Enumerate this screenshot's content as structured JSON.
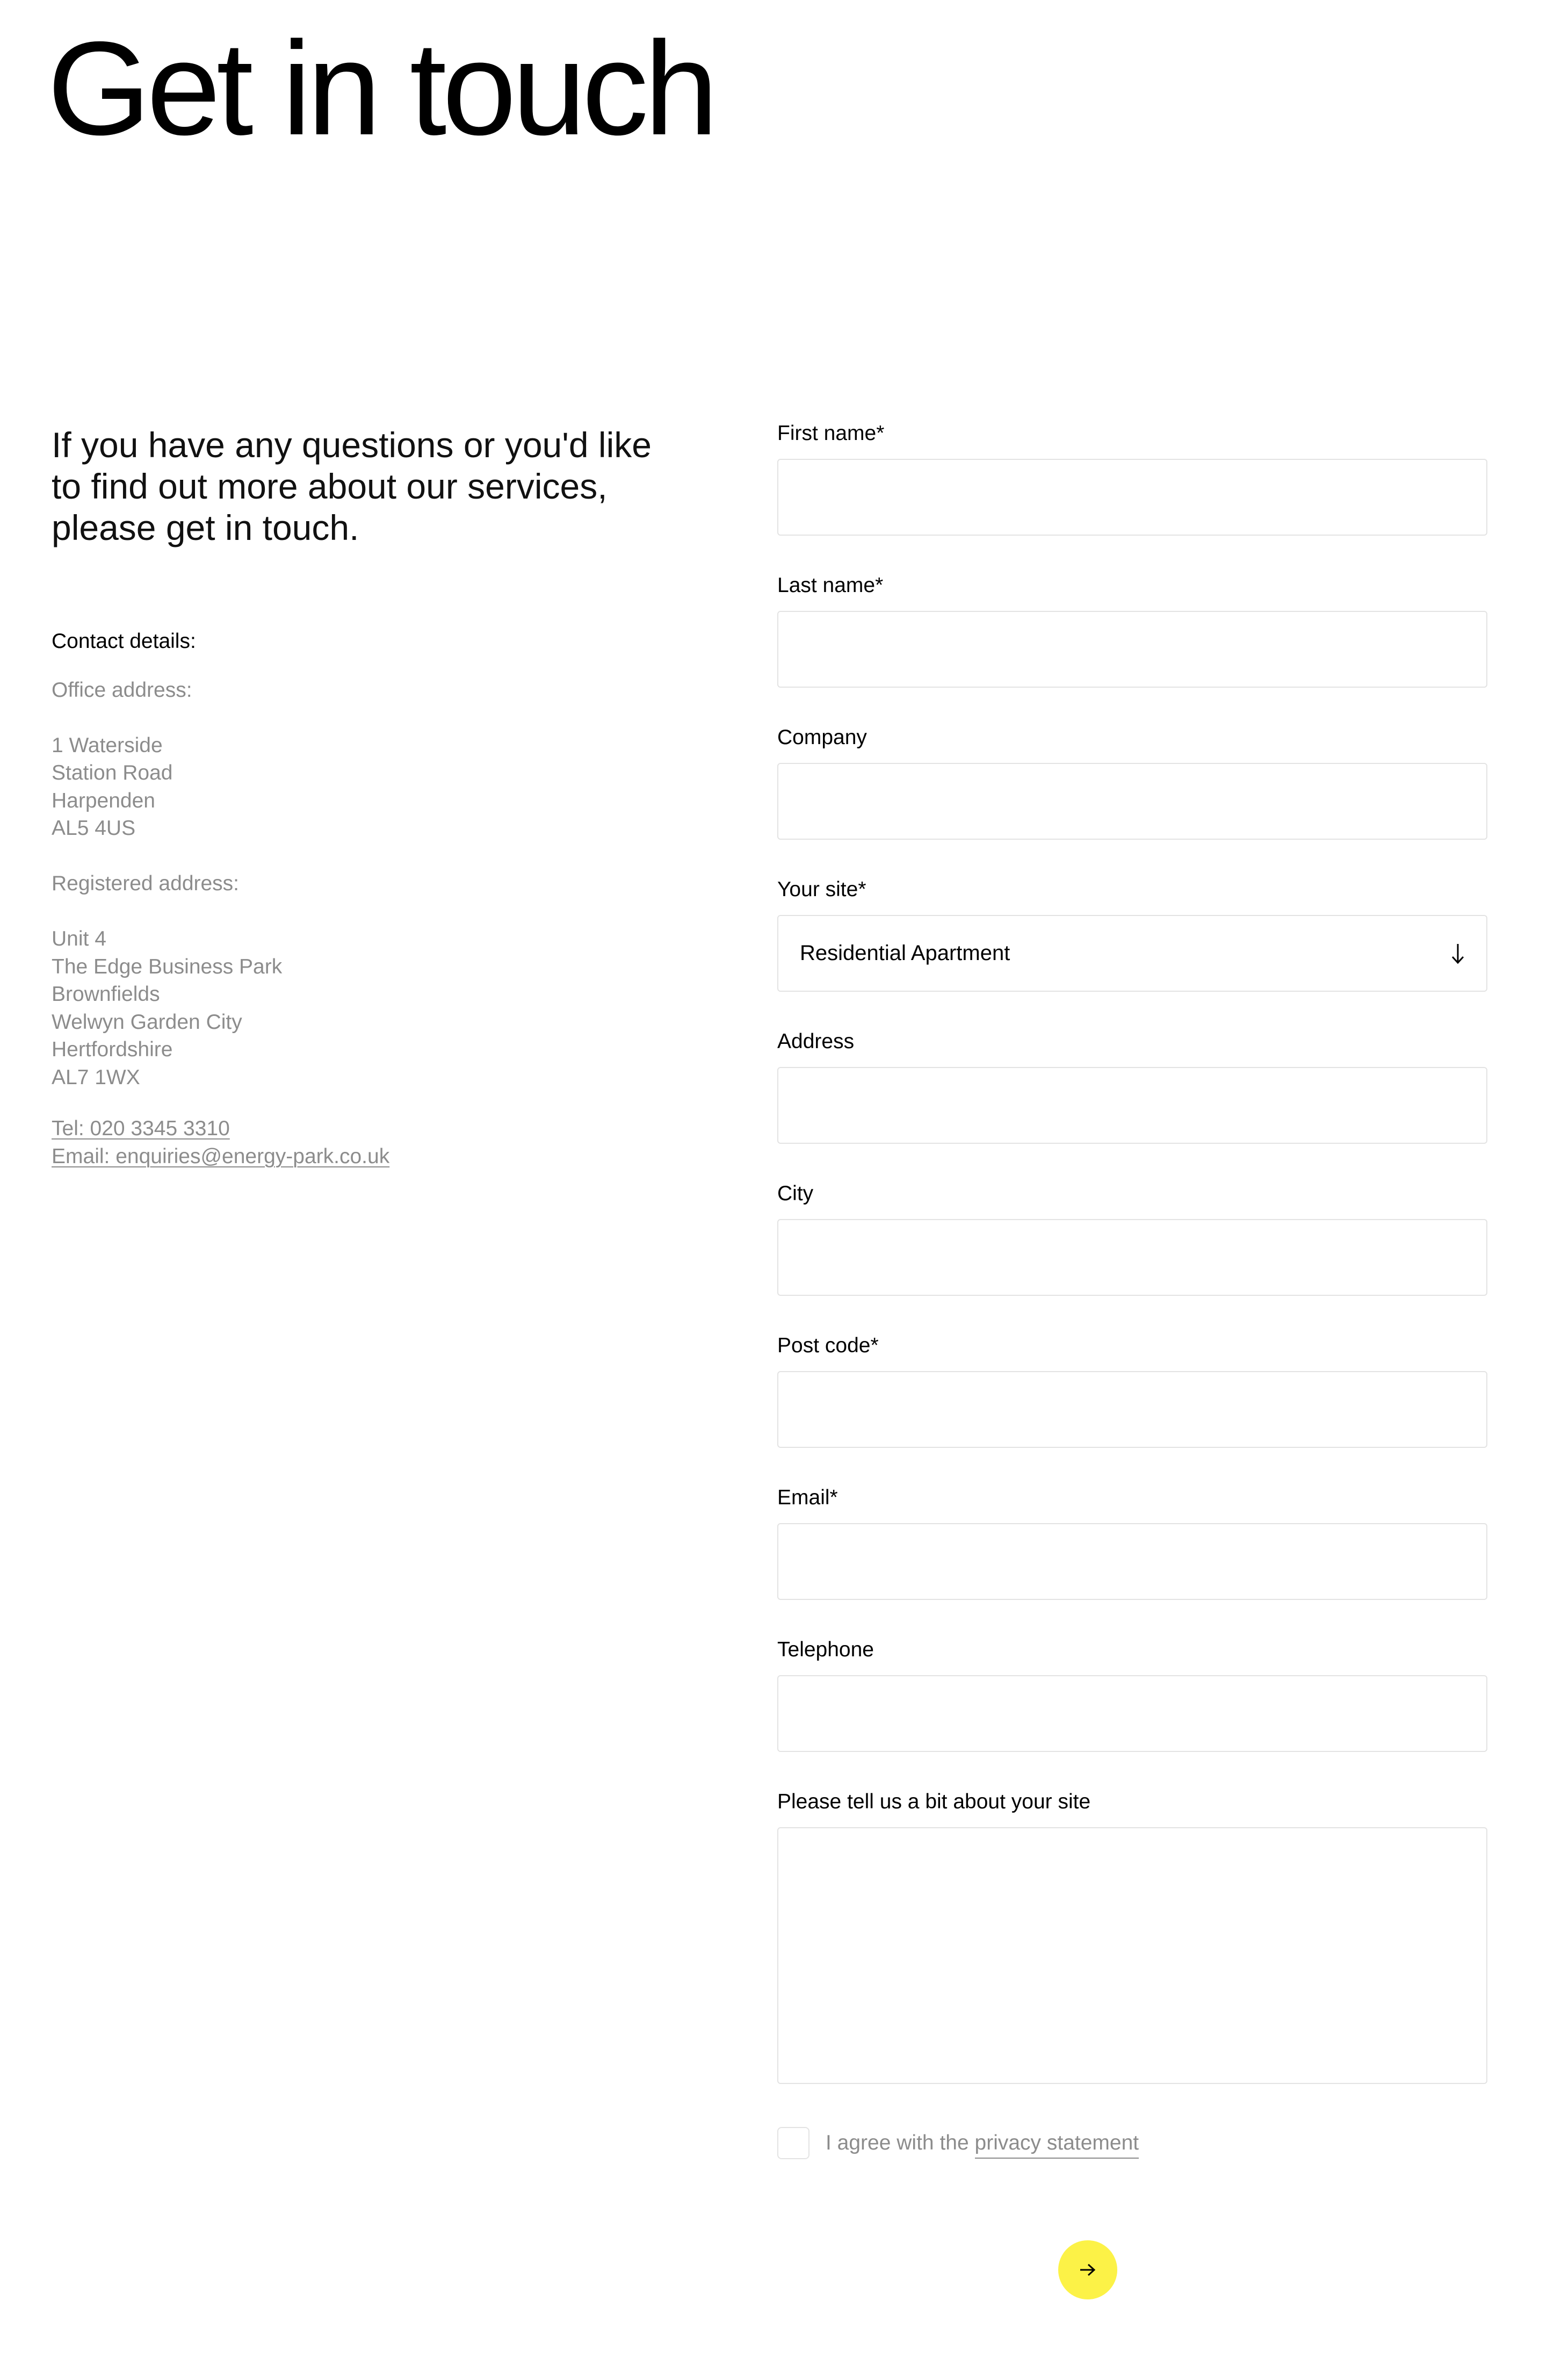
{
  "page": {
    "title": "Get in touch",
    "intro": "If you have any questions or you'd like to find out more about our services, please get in touch."
  },
  "contact": {
    "heading": "Contact details:",
    "office_label": "Office address:",
    "office_address": [
      "1 Waterside",
      "Station Road",
      "Harpenden",
      "AL5 4US"
    ],
    "registered_label": "Registered address:",
    "registered_address": [
      "Unit 4",
      "The Edge Business Park",
      "Brownfields",
      "Welwyn Garden City",
      "Hertfordshire",
      "AL7 1WX"
    ],
    "phone_link": "Tel: 020 3345 3310",
    "email_link": "Email: enquiries@energy-park.co.uk"
  },
  "form": {
    "first_name_label": "First name*",
    "first_name_value": "",
    "last_name_label": "Last name*",
    "last_name_value": "",
    "company_label": "Company",
    "company_value": "",
    "site_label": "Your site*",
    "site_value": "Residential Apartment",
    "address_label": "Address",
    "address_value": "",
    "city_label": "City",
    "city_value": "",
    "postcode_label": "Post code*",
    "postcode_value": "",
    "email_label": "Email*",
    "email_value": "",
    "telephone_label": "Telephone",
    "telephone_value": "",
    "site_info_label": "Please tell us a bit about your site",
    "site_info_value": "",
    "agree_prefix": "I agree with the",
    "privacy_link": "privacy statement",
    "agree_checked": false,
    "submit_icon": "arrow-right-icon"
  },
  "colors": {
    "accent": "#fcf247",
    "text": "#000000",
    "muted_text": "#8c8c8c",
    "input_border": "#e3e3e3"
  }
}
